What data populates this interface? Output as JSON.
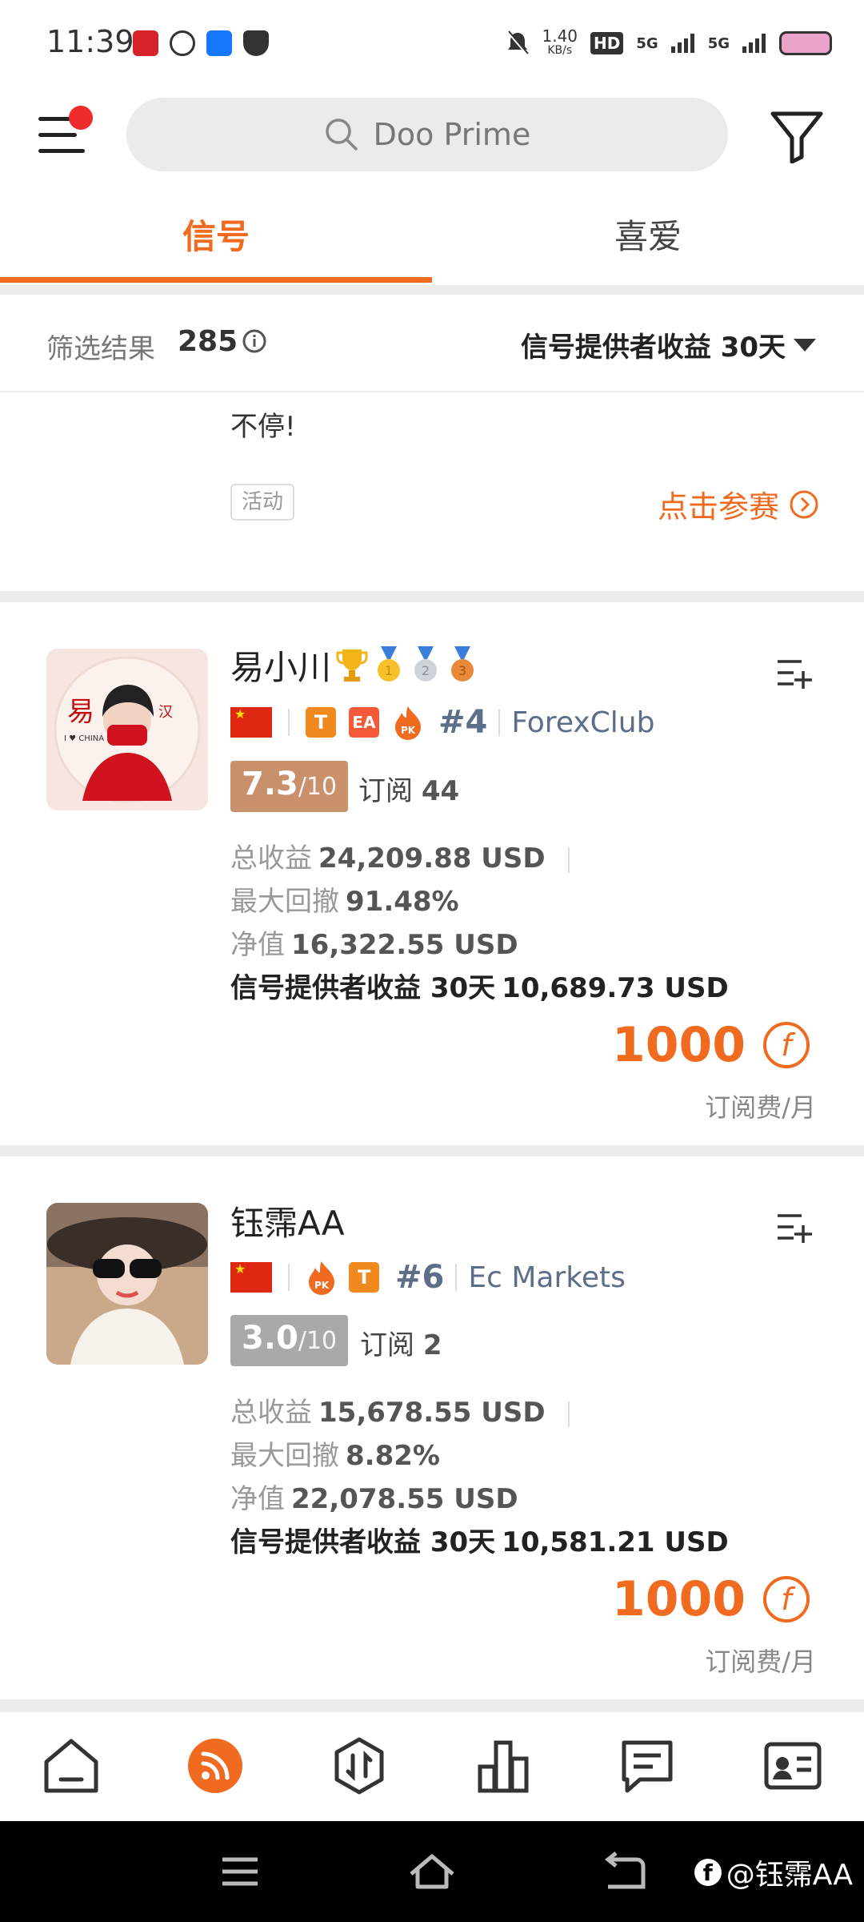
{
  "status_bar": {
    "time": "11:39",
    "net_speed_top": "1.40",
    "net_speed_unit": "KB/s",
    "hd": "HD",
    "sim1": "5G",
    "sim2": "5G"
  },
  "search": {
    "text": "Doo Prime"
  },
  "tabs": [
    {
      "label": "信号",
      "active": true
    },
    {
      "label": "喜爱",
      "active": false
    }
  ],
  "filter_bar": {
    "label": "筛选结果",
    "count": "285",
    "sort_label": "信号提供者收益 30天"
  },
  "promo": {
    "text": "不停!",
    "tag": "活动",
    "link": "点击参赛"
  },
  "signals": [
    {
      "name": "易小川",
      "badges": [
        "T",
        "EA"
      ],
      "rank": "#4",
      "broker": "ForexClub",
      "score": "7.3",
      "score_denom": "/10",
      "score_color": "#c8906b",
      "subs_label": "订阅",
      "subs_count": "44",
      "total_label": "总收益",
      "total_value": "24,209.88 USD",
      "dd_label": "最大回撤",
      "dd_value": "91.48%",
      "equity_label": "净值",
      "equity_value": "16,322.55 USD",
      "provider_label": "信号提供者收益 30天",
      "provider_value": "10,689.73 USD",
      "price": "1000",
      "price_unit": "订阅费/月"
    },
    {
      "name": "钰霈AA",
      "badges": [
        "T"
      ],
      "rank": "#6",
      "broker": "Ec Markets",
      "score": "3.0",
      "score_denom": "/10",
      "score_color": "#a9a9a9",
      "subs_label": "订阅",
      "subs_count": "2",
      "total_label": "总收益",
      "total_value": "15,678.55 USD",
      "dd_label": "最大回撤",
      "dd_value": "8.82%",
      "equity_label": "净值",
      "equity_value": "22,078.55 USD",
      "provider_label": "信号提供者收益 30天",
      "provider_value": "10,581.21 USD",
      "price": "1000",
      "price_unit": "订阅费/月"
    }
  ],
  "bottom_nav": [
    "home-icon",
    "signal-feed-icon",
    "trade-icon",
    "chart-icon",
    "message-icon",
    "profile-card-icon"
  ],
  "watermark": {
    "text": "@钰霈AA"
  },
  "colors": {
    "accent": "#f06a1f",
    "rank_text": "#5d6e88"
  }
}
